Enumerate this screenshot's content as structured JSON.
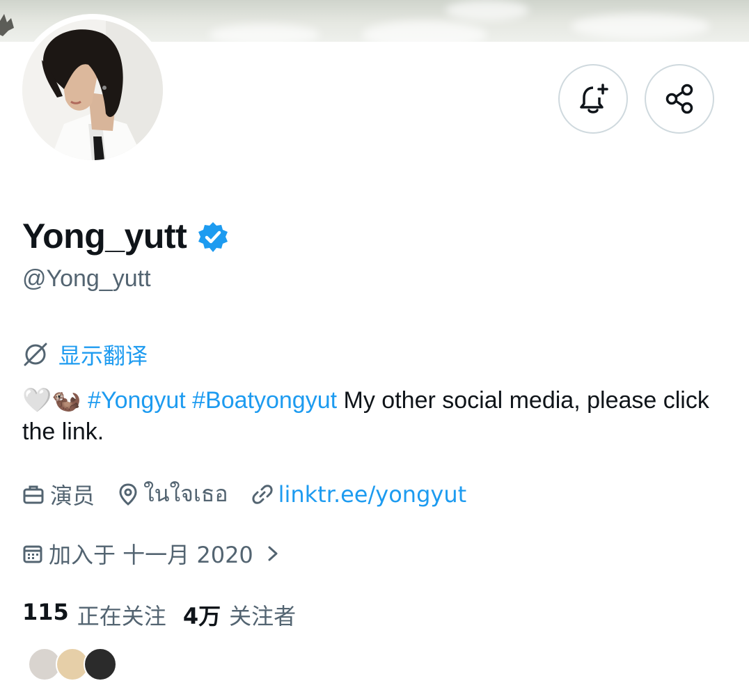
{
  "profile": {
    "display_name": "Yong_yutt",
    "handle": "@Yong_yutt",
    "verified": true,
    "avatar_icon": "profile-photo",
    "translate_label": "显示翻译",
    "bio": {
      "emojis": "🤍🦦",
      "hashtag1": "#Yongyut",
      "hashtag2": "#Boatyongyut",
      "text": "My other social media, please click the link."
    },
    "profession": "演员",
    "location": "ในใจเธอ",
    "link": "linktr.ee/yongyut",
    "joined": "加入于 十一月 2020",
    "following_count": "115",
    "following_label": "正在关注",
    "followers_count": "4万",
    "followers_label": "关注者"
  },
  "actions": {
    "notify_icon": "bell-plus-icon",
    "share_icon": "share-icon"
  },
  "colors": {
    "accent": "#1d9bf0",
    "secondary_text": "#536471",
    "primary_text": "#0f1419",
    "border": "#cfd9de"
  }
}
